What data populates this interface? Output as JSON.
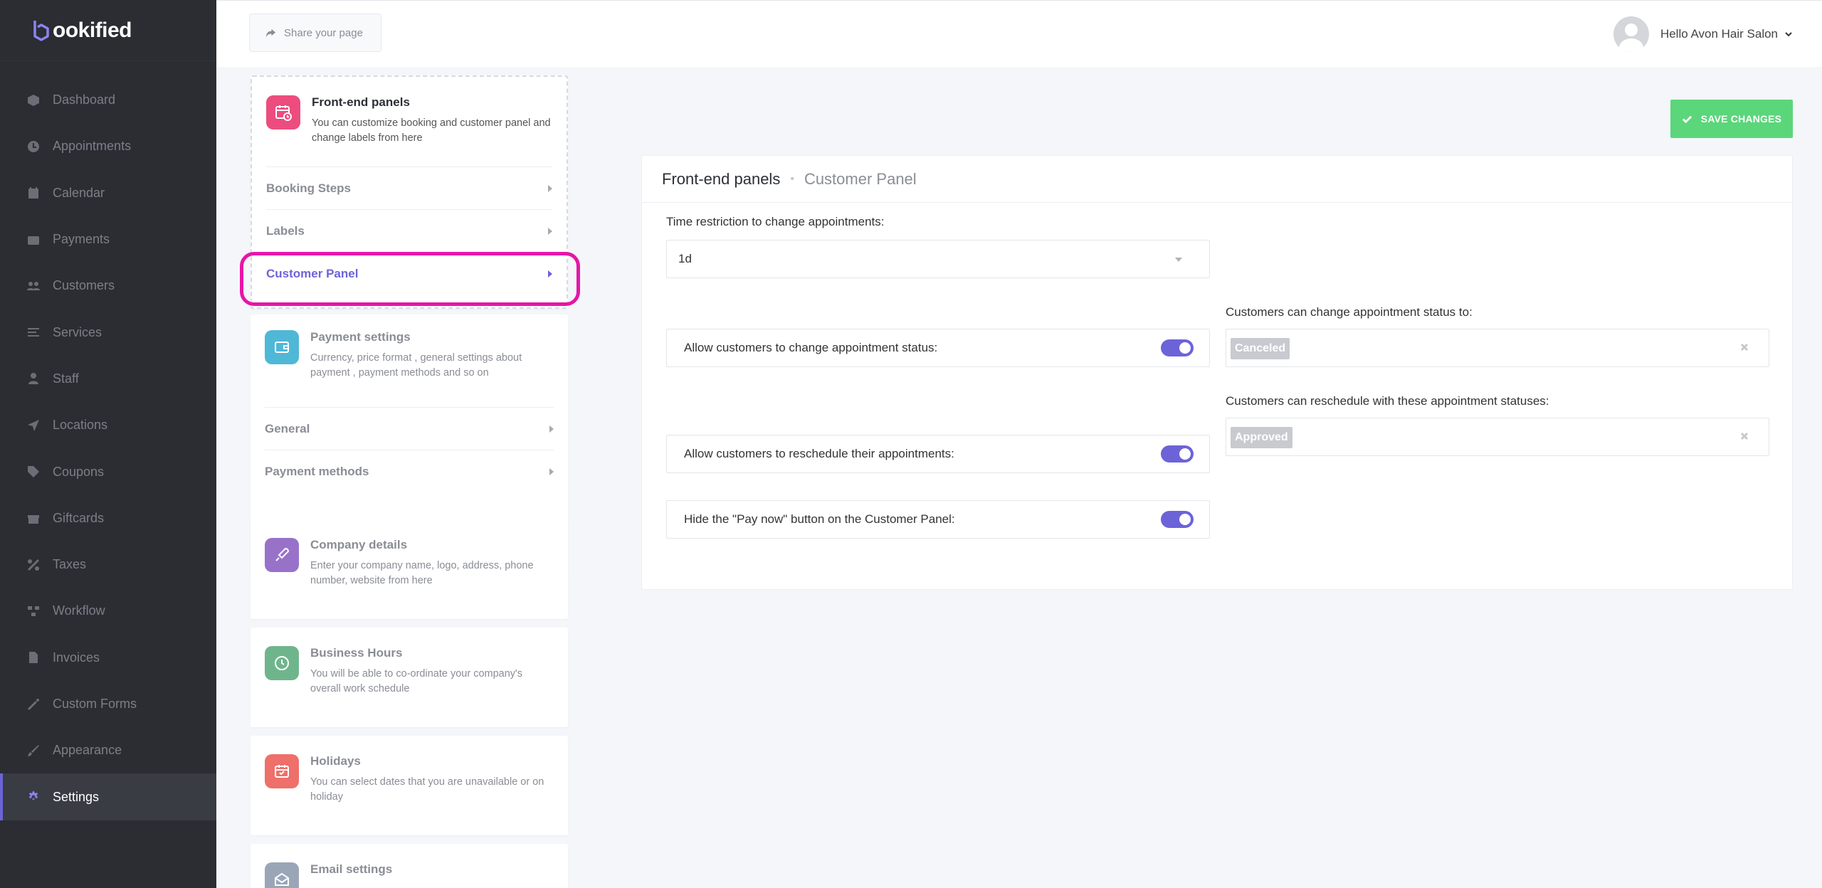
{
  "brand": {
    "name": "ookified"
  },
  "sidebar": {
    "items": [
      {
        "label": "Dashboard",
        "icon": "dashboard-icon"
      },
      {
        "label": "Appointments",
        "icon": "clock-icon"
      },
      {
        "label": "Calendar",
        "icon": "calendar-icon"
      },
      {
        "label": "Payments",
        "icon": "wallet-icon"
      },
      {
        "label": "Customers",
        "icon": "users-icon"
      },
      {
        "label": "Services",
        "icon": "list-icon"
      },
      {
        "label": "Staff",
        "icon": "user-icon"
      },
      {
        "label": "Locations",
        "icon": "location-arrow-icon"
      },
      {
        "label": "Coupons",
        "icon": "tag-icon"
      },
      {
        "label": "Giftcards",
        "icon": "gift-icon"
      },
      {
        "label": "Taxes",
        "icon": "percent-icon"
      },
      {
        "label": "Workflow",
        "icon": "workflow-icon"
      },
      {
        "label": "Invoices",
        "icon": "file-icon"
      },
      {
        "label": "Custom Forms",
        "icon": "magic-icon"
      },
      {
        "label": "Appearance",
        "icon": "brush-icon"
      },
      {
        "label": "Settings",
        "icon": "gear-icon",
        "active": true
      }
    ]
  },
  "topbar": {
    "share_label": "Share your page",
    "user_greeting": "Hello Avon Hair Salon"
  },
  "menu": {
    "frontend": {
      "title": "Front-end panels",
      "desc": "You can customize booking and customer panel and change labels from here",
      "items": [
        "Booking Steps",
        "Labels",
        "Customer Panel"
      ]
    },
    "payment": {
      "title": "Payment settings",
      "desc": "Currency, price format , general settings about payment , payment methods and so on",
      "items": [
        "General",
        "Payment methods"
      ]
    },
    "company": {
      "title": "Company details",
      "desc": "Enter your company name, logo, address, phone number, website from here"
    },
    "hours": {
      "title": "Business Hours",
      "desc": "You will be able to co-ordinate your company's overall work schedule"
    },
    "holidays": {
      "title": "Holidays",
      "desc": "You can select dates that you are unavailable or on holiday"
    },
    "email": {
      "title": "Email settings"
    }
  },
  "content": {
    "save_label": "SAVE CHANGES",
    "breadcrumb_main": "Front-end panels",
    "breadcrumb_sub": "Customer Panel",
    "time_restriction_label": "Time restriction to change appointments:",
    "time_restriction_value": "1d",
    "allow_status_label": "Allow customers to change appointment status:",
    "allow_status_on": true,
    "status_to_label": "Customers can change appointment status to:",
    "status_to_tag": "Canceled",
    "allow_reschedule_label": "Allow customers to reschedule their appointments:",
    "allow_reschedule_on": true,
    "reschedule_statuses_label": "Customers can reschedule with these appointment statuses:",
    "reschedule_statuses_tag": "Approved",
    "hide_paynow_label": "Hide the \"Pay now\" button on the Customer Panel:",
    "hide_paynow_on": true
  },
  "colors": {
    "accent": "#6c63d8",
    "save": "#5bd67a",
    "highlight": "#e616a8",
    "sidebar_bg": "#2b2d33"
  }
}
